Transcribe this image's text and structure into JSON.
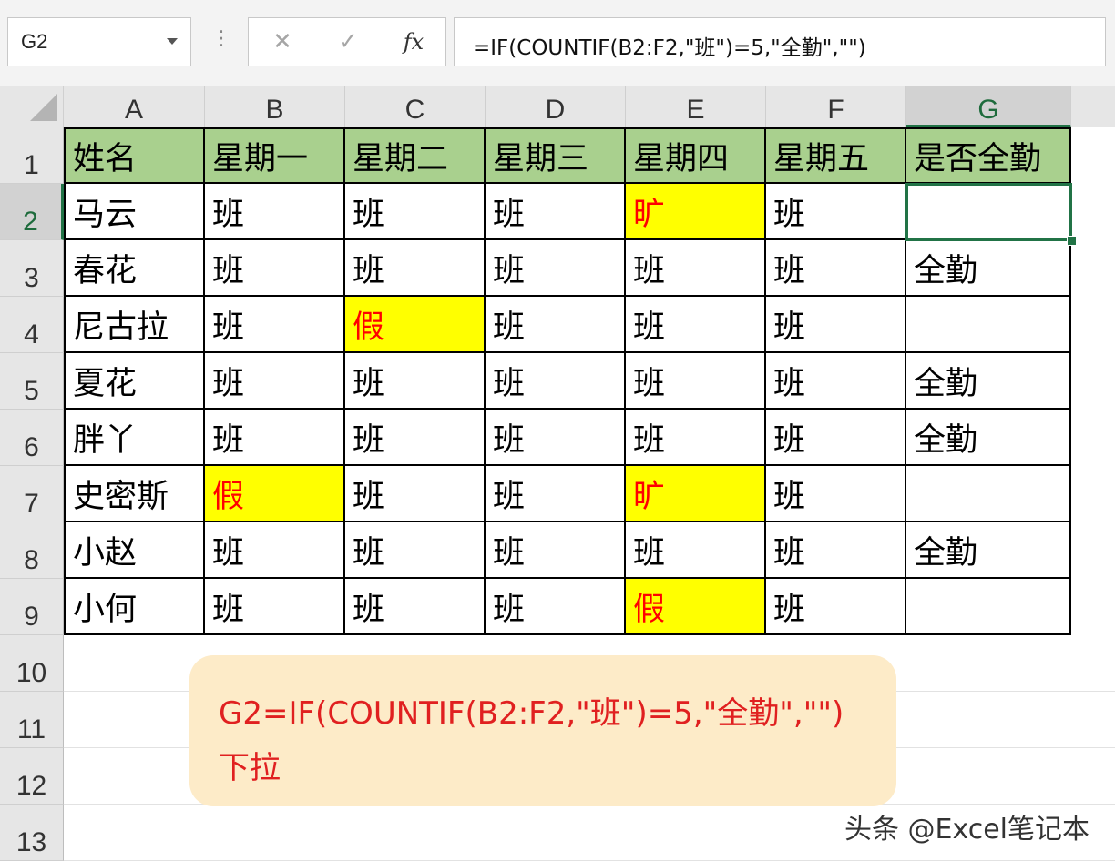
{
  "formula_bar": {
    "name_box": "G2",
    "separator": "⋮",
    "cancel_glyph": "✕",
    "enter_glyph": "✓",
    "fx_glyph": "fx",
    "formula": "=IF(COUNTIF(B2:F2,\"班\")=5,\"全勤\",\"\")"
  },
  "columns": [
    "A",
    "B",
    "C",
    "D",
    "E",
    "F",
    "G"
  ],
  "rows": [
    "1",
    "2",
    "3",
    "4",
    "5",
    "6",
    "7",
    "8",
    "9",
    "10",
    "11",
    "12",
    "13"
  ],
  "table": {
    "header": [
      "姓名",
      "星期一",
      "星期二",
      "星期三",
      "星期四",
      "星期五",
      "是否全勤"
    ],
    "rows": [
      [
        "马云",
        "班",
        "班",
        "班",
        "旷",
        "班",
        ""
      ],
      [
        "春花",
        "班",
        "班",
        "班",
        "班",
        "班",
        "全勤"
      ],
      [
        "尼古拉",
        "班",
        "假",
        "班",
        "班",
        "班",
        ""
      ],
      [
        "夏花",
        "班",
        "班",
        "班",
        "班",
        "班",
        "全勤"
      ],
      [
        "胖丫",
        "班",
        "班",
        "班",
        "班",
        "班",
        "全勤"
      ],
      [
        "史密斯",
        "假",
        "班",
        "班",
        "旷",
        "班",
        ""
      ],
      [
        "小赵",
        "班",
        "班",
        "班",
        "班",
        "班",
        "全勤"
      ],
      [
        "小何",
        "班",
        "班",
        "班",
        "假",
        "班",
        ""
      ]
    ]
  },
  "active_cell": "G2",
  "note": {
    "line1": "G2=IF(COUNTIF(B2:F2,\"班\")=5,\"全勤\",\"\")",
    "line2": "下拉"
  },
  "watermark": "头条 @Excel笔记本",
  "colors": {
    "header_fill": "#a9d08e",
    "highlight_fill": "#ffff00",
    "highlight_text": "#ff0000",
    "selection": "#217346",
    "note_bg": "#fdebc8",
    "note_text": "#e02020"
  }
}
